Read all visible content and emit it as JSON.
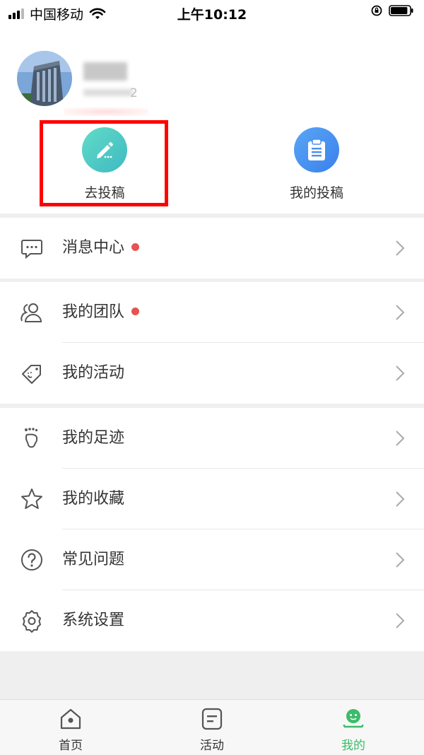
{
  "status_bar": {
    "carrier": "中国移动",
    "time": "上午10:12",
    "battery_level": 0.9
  },
  "profile": {
    "subtitle_tail": "2"
  },
  "actions": [
    {
      "label": "去投稿",
      "icon": "pencil-icon",
      "color": "#4ecdc4"
    },
    {
      "label": "我的投稿",
      "icon": "clipboard-icon",
      "color": "#4a90f0"
    }
  ],
  "menu": [
    {
      "label": "消息中心",
      "icon": "message-icon",
      "has_dot": true
    },
    {
      "label": "我的团队",
      "icon": "team-icon",
      "has_dot": true
    },
    {
      "label": "我的活动",
      "icon": "tag-icon",
      "has_dot": false
    },
    {
      "label": "我的足迹",
      "icon": "footprint-icon",
      "has_dot": false
    },
    {
      "label": "我的收藏",
      "icon": "star-icon",
      "has_dot": false
    },
    {
      "label": "常见问题",
      "icon": "question-icon",
      "has_dot": false
    },
    {
      "label": "系统设置",
      "icon": "settings-icon",
      "has_dot": false
    }
  ],
  "tabbar": [
    {
      "label": "首页",
      "icon": "home-icon",
      "active": false
    },
    {
      "label": "活动",
      "icon": "activity-icon",
      "active": false
    },
    {
      "label": "我的",
      "icon": "profile-icon",
      "active": true
    }
  ],
  "colors": {
    "accent_green": "#3cbc6a",
    "highlight_red": "#ff0000",
    "badge_red": "#e85252"
  }
}
